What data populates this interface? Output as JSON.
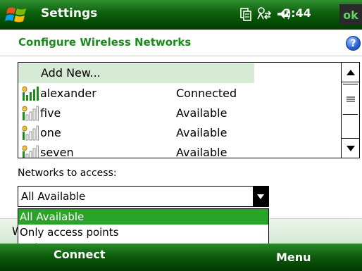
{
  "titlebar": {
    "title": "Settings",
    "time": "2:44",
    "ok_label": "ok"
  },
  "header": {
    "title": "Configure Wireless Networks",
    "help_label": "?"
  },
  "networks": {
    "add_new_label": "Add New...",
    "items": [
      {
        "name": "alexander",
        "status": "Connected",
        "signal": "full"
      },
      {
        "name": "five",
        "status": "Available",
        "signal": "weak"
      },
      {
        "name": "one",
        "status": "Available",
        "signal": "weak"
      },
      {
        "name": "seven",
        "status": "Available",
        "signal": "weak"
      }
    ]
  },
  "access": {
    "label": "Networks to access:",
    "selected": "All Available",
    "options": [
      "All Available",
      "Only access points",
      "Only computer-to-computer"
    ]
  },
  "partial_text": "W",
  "softkeys": {
    "left": "Connect",
    "right": "Menu"
  },
  "colors": {
    "brand_green": "#1b8a1b",
    "selection_green": "#28a428",
    "row_highlight": "#d6ead6"
  }
}
